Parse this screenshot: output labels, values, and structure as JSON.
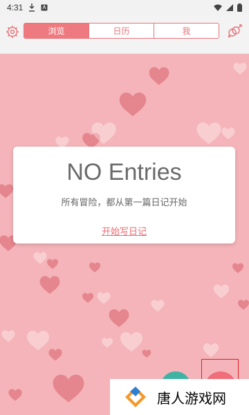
{
  "status": {
    "time": "4:31"
  },
  "header": {
    "tabs": [
      {
        "label": "浏览",
        "active": true
      },
      {
        "label": "日历",
        "active": false
      },
      {
        "label": "我",
        "active": false
      }
    ]
  },
  "empty": {
    "title": "NO Entries",
    "subtitle": "所有冒险，都从第一篇日记开始",
    "link": "开始写日记"
  },
  "watermark": {
    "brand": "唐人游戏网"
  },
  "colors": {
    "accent": "#ee7a7f",
    "background": "#f4b4b9",
    "fab_green": "#3fb3a3",
    "fab_red": "#f06e7a"
  }
}
